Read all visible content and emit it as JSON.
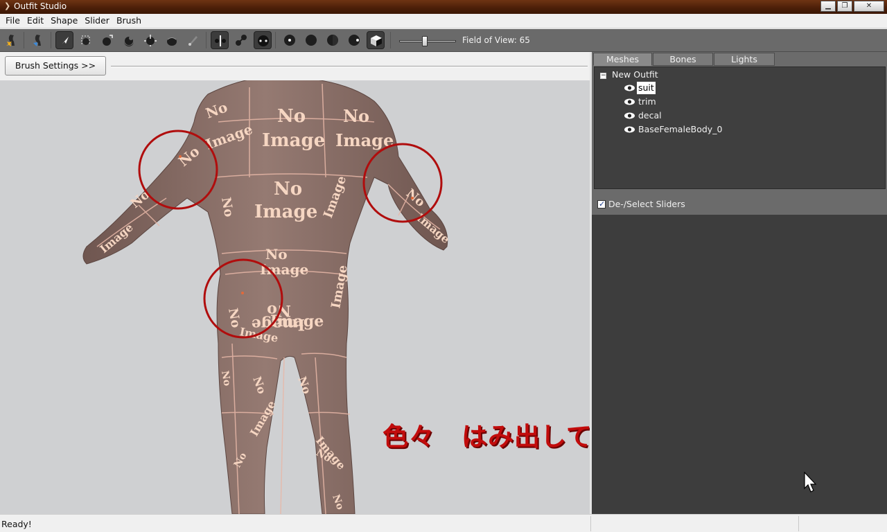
{
  "window": {
    "title": "Outfit Studio"
  },
  "menu": [
    "File",
    "Edit",
    "Shape",
    "Slider",
    "Brush"
  ],
  "toolbar": {
    "fov_label": "Field of View: 65",
    "fov_value": 65,
    "tools": [
      "load-reference-icon",
      "load-outfit-icon",
      "select-tool-icon",
      "mask-tool-icon",
      "inflate-brush-icon",
      "deflate-brush-icon",
      "move-brush-icon",
      "smooth-brush-icon",
      "weight-brush-icon",
      "mirror-x-icon",
      "connected-only-icon",
      "show-points-icon",
      "mesh-view-point-icon",
      "mesh-view-solid-icon",
      "mesh-view-half-icon",
      "mesh-view-dark-icon",
      "texture-toggle-icon"
    ]
  },
  "brush_settings_label": "Brush Settings >>",
  "annotation_text": "色々　はみ出しています",
  "texture_placeholder": {
    "line1": "No",
    "line2": "Image"
  },
  "right_panel": {
    "tabs": [
      "Meshes",
      "Bones",
      "Lights"
    ],
    "active_tab": "Meshes",
    "tree_root": "New Outfit",
    "meshes": [
      "suit",
      "trim",
      "decal",
      "BaseFemaleBody_0"
    ],
    "selected_mesh": "suit",
    "slider_toggle_label": "De-/Select Sliders",
    "slider_toggle_checked": true
  },
  "status": {
    "text": "Ready!"
  },
  "colors": {
    "toolbar_bg": "#6a6a6a",
    "panel_dark": "#3d3d3d",
    "title_bar": "#5a2a0e",
    "annotation_red": "#c20c0c",
    "circle_red": "#b00d0d",
    "body_skin": "#8a7069"
  }
}
